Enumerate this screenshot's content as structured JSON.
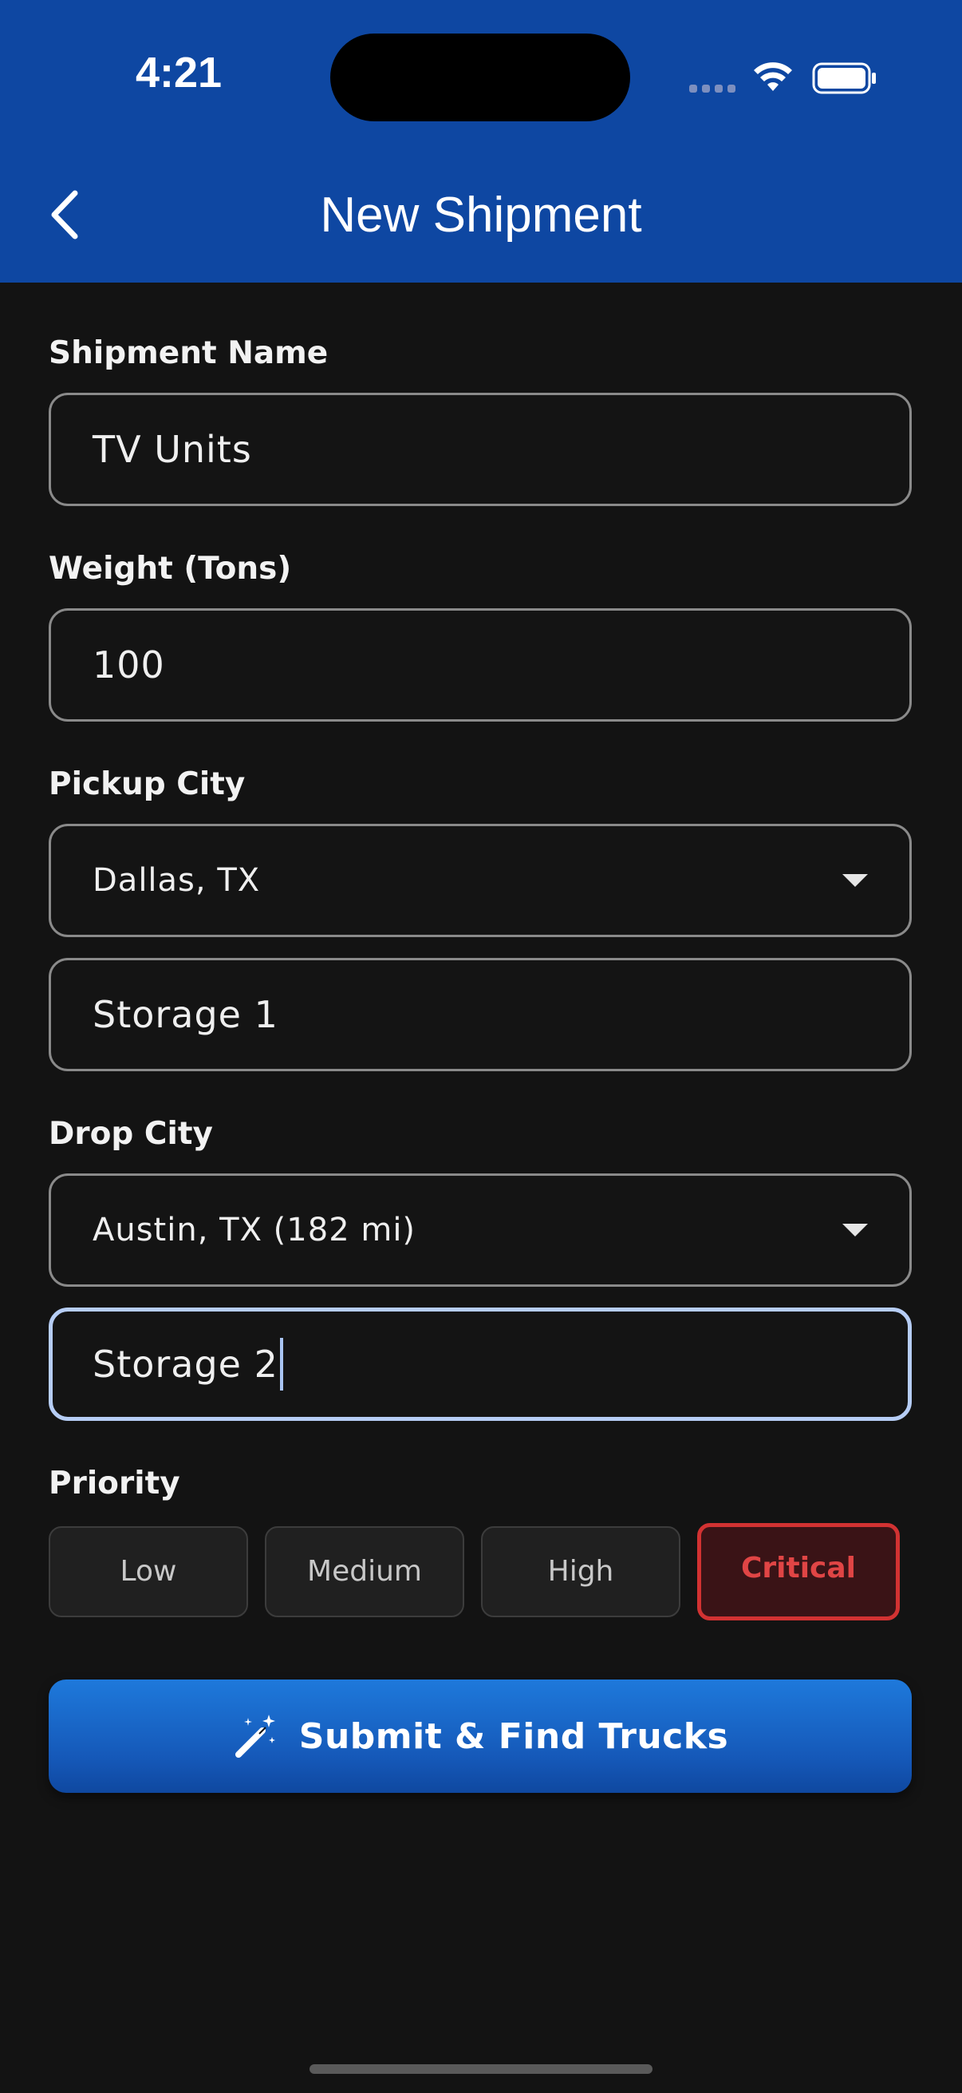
{
  "status_bar": {
    "time": "4:21"
  },
  "header": {
    "title": "New Shipment",
    "back_icon": "chevron-left-icon"
  },
  "form": {
    "shipment_name": {
      "label": "Shipment Name",
      "value": "TV Units"
    },
    "weight": {
      "label": "Weight (Tons)",
      "value": "100"
    },
    "pickup": {
      "label": "Pickup City",
      "city": "Dallas, TX",
      "location": "Storage 1"
    },
    "drop": {
      "label": "Drop City",
      "city": "Austin, TX (182 mi)",
      "location": "Storage 2"
    },
    "priority": {
      "label": "Priority",
      "options": [
        "Low",
        "Medium",
        "High",
        "Critical"
      ],
      "selected": "Critical"
    }
  },
  "submit": {
    "label": "Submit & Find Trucks",
    "icon": "magic-wand-icon"
  },
  "colors": {
    "header_bg": "#0e47a2",
    "background": "#131313",
    "accent": "#1e79db",
    "critical": "#d23232",
    "focus_border": "#b6cdf5"
  }
}
